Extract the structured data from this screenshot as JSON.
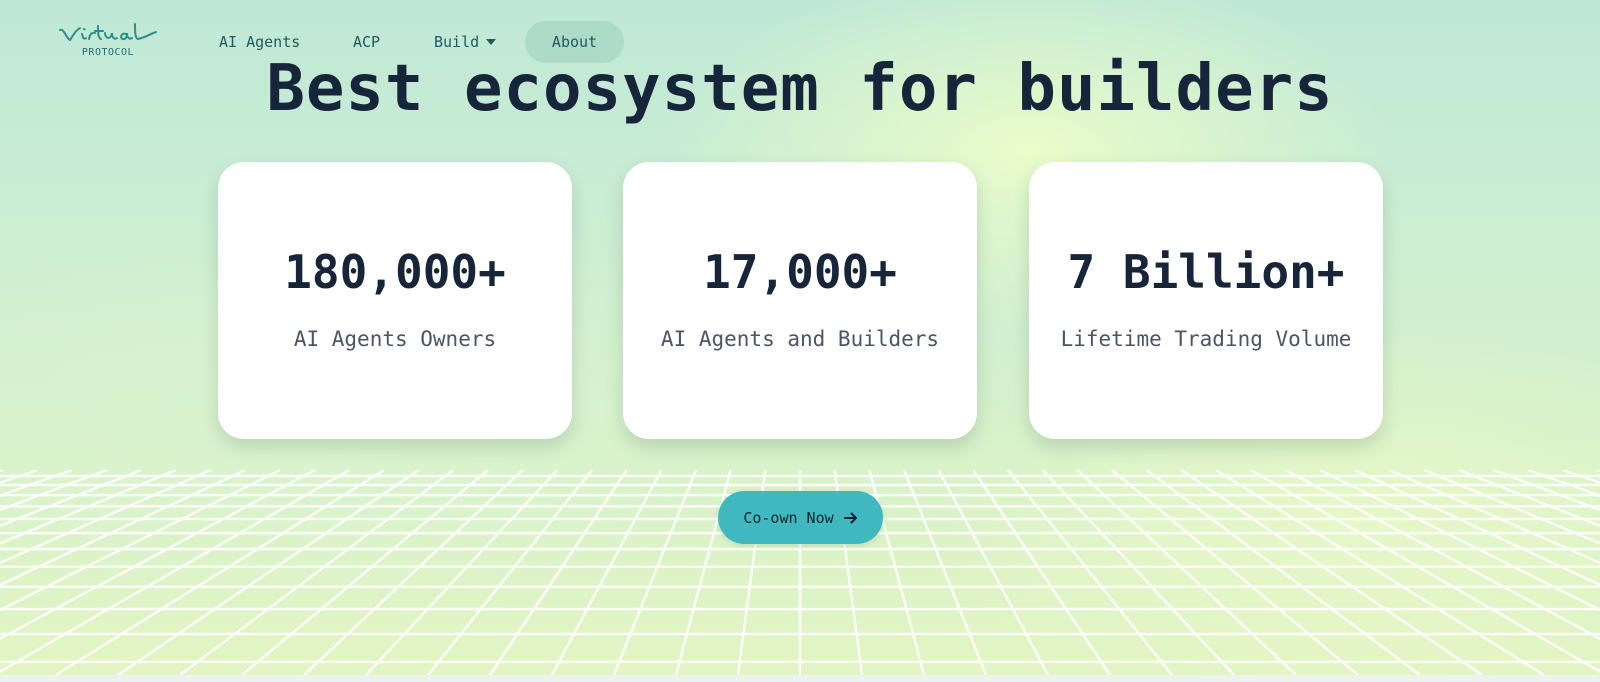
{
  "brand": {
    "logo_script": "Virtuals",
    "logo_sub": "PROTOCOL"
  },
  "nav": {
    "items": [
      {
        "label": "AI Agents"
      },
      {
        "label": "ACP"
      },
      {
        "label": "Build",
        "has_dropdown": true
      },
      {
        "label": "About",
        "active": true
      }
    ]
  },
  "hero": {
    "title": "Best ecosystem for builders"
  },
  "stats": [
    {
      "value": "180,000+",
      "label": "AI Agents Owners"
    },
    {
      "value": "17,000+",
      "label": "AI Agents and Builders"
    },
    {
      "value": "7 Billion+",
      "label": "Lifetime Trading Volume"
    }
  ],
  "cta": {
    "label": "Co-own Now",
    "icon": "arrow-right-icon",
    "color": "#3fb8c0"
  },
  "colors": {
    "heading": "#17253a",
    "nav_text": "#1f5a60",
    "card_bg": "#ffffff"
  }
}
